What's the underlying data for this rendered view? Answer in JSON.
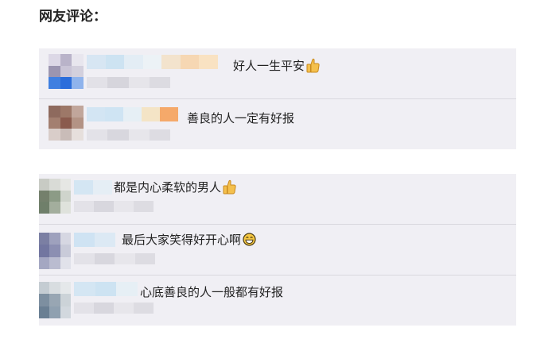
{
  "heading": "网友评论：",
  "comments": [
    {
      "text": "好人一生平安",
      "icon": "thumbs-up-icon"
    },
    {
      "text": "善良的人一定有好报",
      "icon": ""
    },
    {
      "text": "都是内心柔软的男人",
      "icon": "thumbs-up-icon"
    },
    {
      "text": "最后大家笑得好开心啊",
      "icon": "grin-emoji-icon"
    },
    {
      "text": "心底善良的人一般都有好报",
      "icon": ""
    }
  ],
  "colors": {
    "panel_bg": "#f0eff4",
    "divider": "#d9d8de",
    "text": "#222222"
  }
}
